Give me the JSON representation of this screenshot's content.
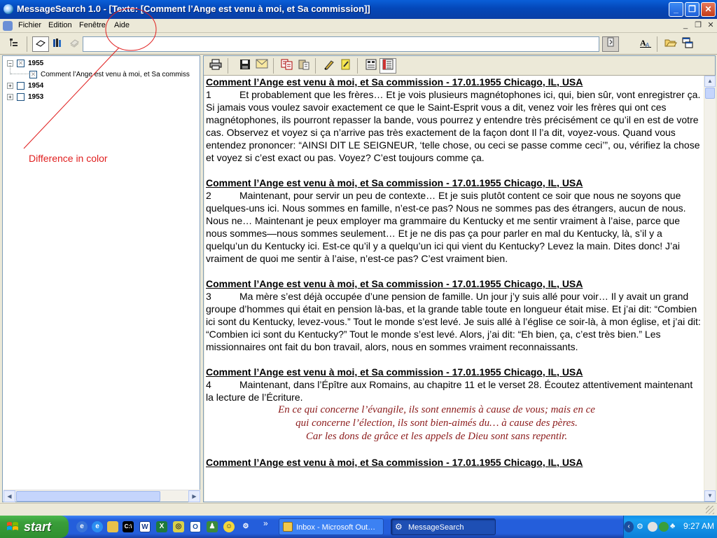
{
  "window": {
    "title": "MessageSearch 1.0 - [Texte: [Comment l’Ange est venu à moi, et Sa commission]]",
    "controls": {
      "minimize": "_",
      "maximize": "❐",
      "close": "✕"
    }
  },
  "menu": {
    "items": [
      "Fichier",
      "Edition",
      "Fenêtre",
      "Aide"
    ],
    "mdi_controls": {
      "minimize": "_",
      "restore": "❐",
      "close": "✕"
    }
  },
  "toolbar": {
    "icons": [
      "tree-view-icon",
      "book-icon",
      "books-icon",
      "pages-icon"
    ],
    "search_value": "",
    "right_icons": [
      "search-go-icon",
      "font-icon",
      "open-folder-icon",
      "tile-windows-icon"
    ]
  },
  "tree": {
    "nodes": [
      {
        "label": "1955",
        "expanded": true,
        "checked": true
      },
      {
        "label": "Comment l’Ange est venu à moi, et Sa commiss",
        "child": true,
        "checked": true
      },
      {
        "label": "1954",
        "expanded": false,
        "checked": false
      },
      {
        "label": "1953",
        "expanded": false,
        "checked": false
      }
    ]
  },
  "doc_toolbar": {
    "icons": [
      "print-icon",
      "save-icon",
      "email-icon",
      "copy-icon",
      "paste-icon",
      "highlight-pen-icon",
      "note-icon",
      "view-paragraphs-icon",
      "view-list-icon"
    ]
  },
  "document": {
    "heading": "Comment l’Ange est venu à moi, et Sa commission -  17.01.1955 Chicago, IL, USA",
    "paragraphs": [
      {
        "num": "1",
        "text": "Et probablement que les frères… Et je vois plusieurs magnétophones ici, qui, bien sûr, vont enregistrer ça. Si jamais vous voulez savoir exactement ce que le Saint-Esprit vous a dit, venez voir les frères qui ont ces magnétophones, ils pourront repasser la bande, vous pourrez y entendre très précisément ce qu’il en est de votre cas. Observez et voyez si ça n’arrive pas très exactement de la façon dont Il l’a dit, voyez-vous. Quand vous entendez prononcer: “AINSI DIT LE SEIGNEUR, ‘telle chose, ou ceci se passe comme ceci’”, ou, vérifiez la chose et voyez si c’est exact ou pas. Voyez? C’est toujours comme ça."
      },
      {
        "num": "2",
        "text": "Maintenant, pour servir un peu de contexte… Et je suis plutôt content ce soir que nous ne soyons que quelques-uns ici. Nous sommes en famille, n’est-ce pas? Nous ne sommes pas des étrangers, aucun de nous. Nous ne… Maintenant je peux employer ma grammaire du Kentucky et me sentir vraiment à l’aise, parce que nous sommes—nous sommes seulement… Et je ne dis pas ça pour parler en mal du Kentucky, là, s’il y a quelqu’un du Kentucky ici. Est-ce qu’il y a quelqu’un ici qui vient du Kentucky? Levez la main. Dites donc! J’ai vraiment de quoi me sentir à l’aise, n’est-ce pas? C’est vraiment bien."
      },
      {
        "num": "3",
        "text": "Ma mère s’est déjà occupée d’une pension de famille. Un jour j’y suis allé pour voir… Il y avait un grand groupe d’hommes qui était en pension là-bas, et la grande table toute en longueur était mise. Et j’ai dit: “Combien ici sont du Kentucky, levez-vous.” Tout le monde s’est levé. Je suis allé à l’église ce soir-là, à mon église, et j’ai dit: “Combien ici sont du Kentucky?” Tout le monde s’est levé. Alors, j’ai dit: “Eh bien, ça, c’est très bien.” Les missionnaires ont fait du bon travail, alors, nous en sommes vraiment reconnaissants."
      },
      {
        "num": "4",
        "text": "Maintenant, dans l’Épître aux Romains, au chapitre 11 et le verset 28. Écoutez attentivement maintenant la lecture de l’Écriture."
      }
    ],
    "quote_lines": [
      "En ce qui concerne l’évangile, ils sont ennemis à cause de vous; mais en ce",
      "qui concerne l’élection, ils sont bien-aimés du… à cause des pères.",
      "Car les dons de grâce et les appels de Dieu sont sans repentir."
    ]
  },
  "annotation": {
    "text": "Difference in color",
    "color": "#e01e1e"
  },
  "taskbar": {
    "start_label": "start",
    "quicklaunch": [
      "ie-settings-icon",
      "ie-icon",
      "folder-icon",
      "cmd-icon",
      "word-icon",
      "excel-icon",
      "media-icon",
      "outlook-icon",
      "messenger-icon",
      "smiley-icon",
      "messagesearch-icon"
    ],
    "overflow": "»",
    "tasks": [
      {
        "label": "Inbox - Microsoft Out…",
        "active": false
      },
      {
        "label": "MessageSearch",
        "active": true
      }
    ],
    "clock": "9:27 AM"
  }
}
